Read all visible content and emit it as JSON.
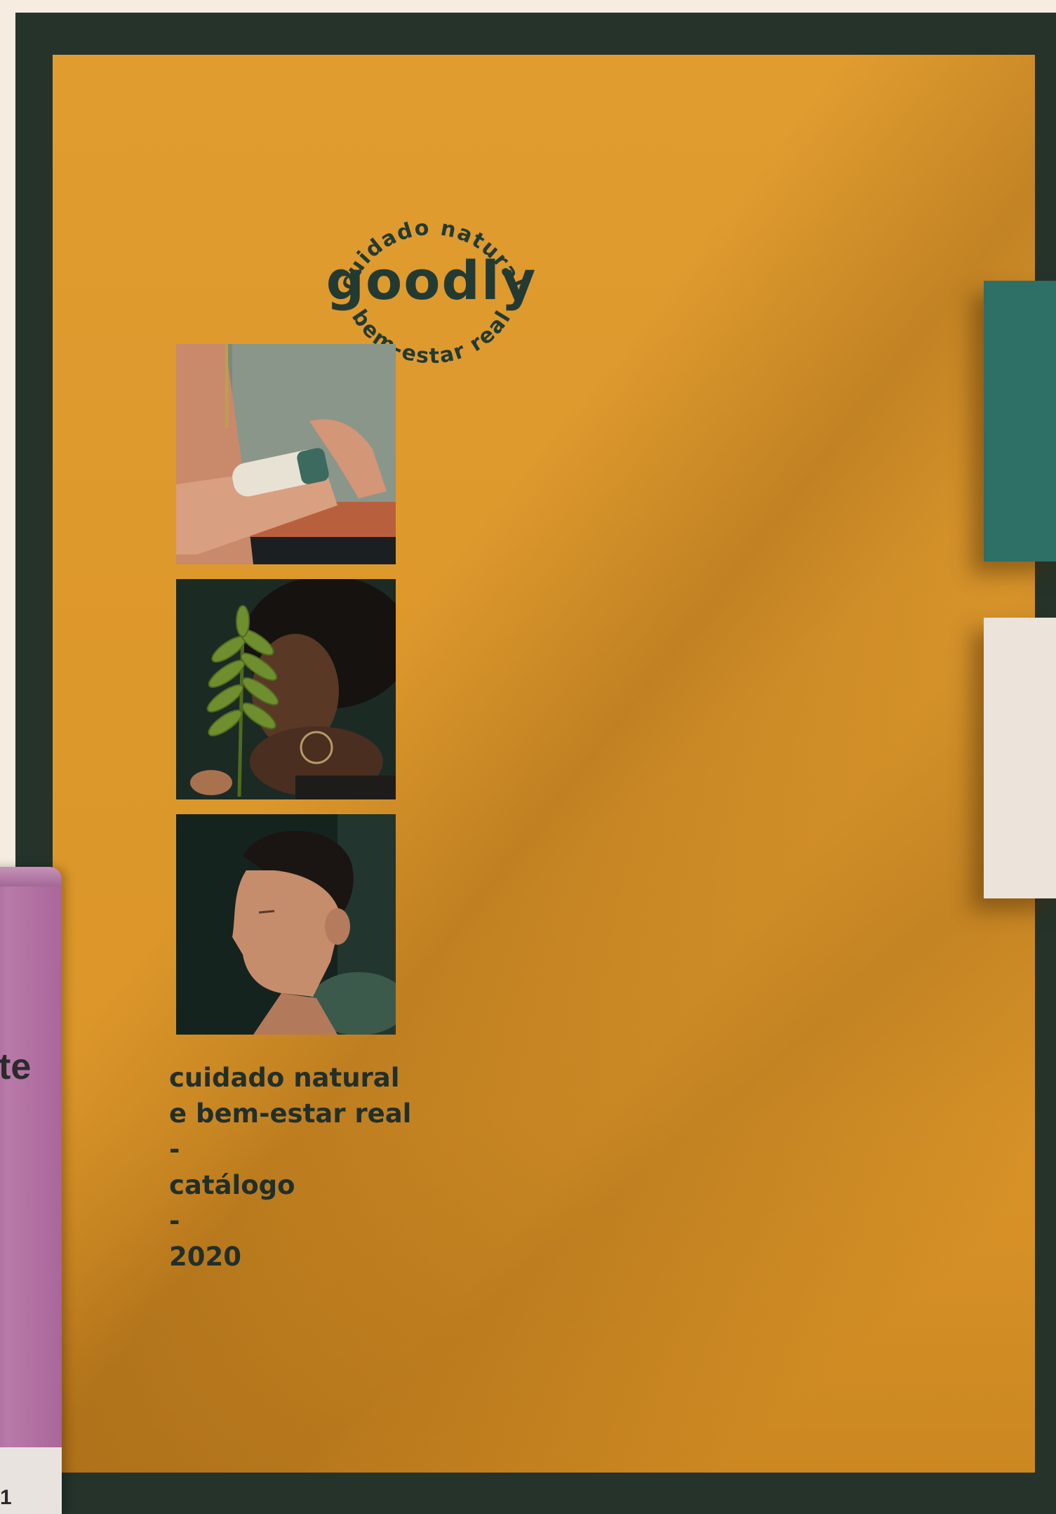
{
  "brand": {
    "name": "goodly",
    "seal_top": "cuidado natural",
    "seal_bottom": "bem-estar real"
  },
  "cover_text": {
    "lines": [
      "cuidado natural",
      "e bem-estar real",
      "-",
      "catálogo",
      "-",
      "2020"
    ]
  },
  "tube": {
    "fragment": "te",
    "band_text": "1"
  },
  "photos": [
    {
      "icon": "arm-stick-product-photo"
    },
    {
      "icon": "woman-with-leaf-photo"
    },
    {
      "icon": "profile-portrait-photo"
    }
  ],
  "colors": {
    "background": "#f6ece0",
    "board": "#25332b",
    "cover": "#e09c2f",
    "ink": "#233a33",
    "swatch_teal": "#2e6f66",
    "swatch_cream": "#ece4da",
    "tube": "#b87aa8"
  }
}
